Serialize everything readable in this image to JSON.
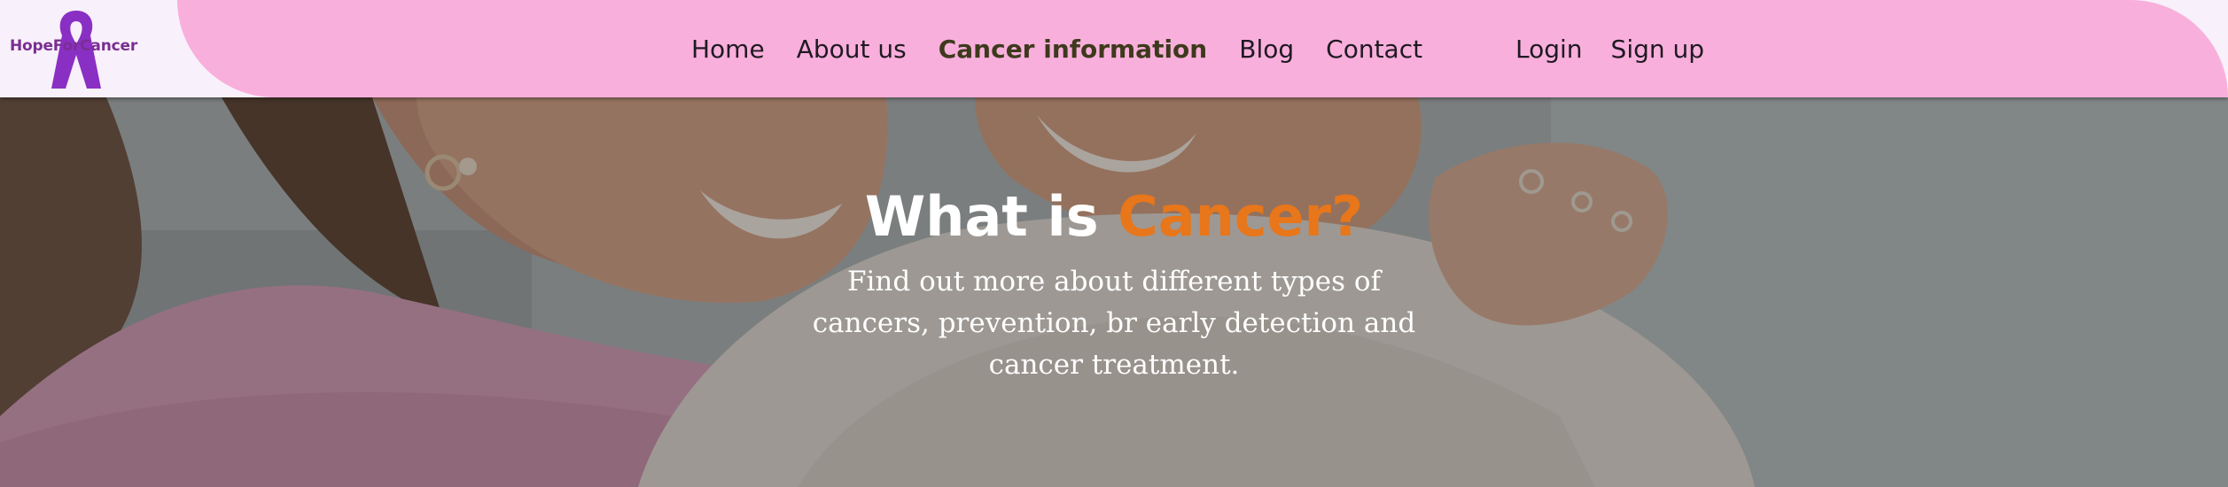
{
  "brand": {
    "name": "HopeForCancer",
    "color": "#7a2e92",
    "mark_color": "#8a2fc4"
  },
  "nav": {
    "items": [
      {
        "label": "Home",
        "active": false
      },
      {
        "label": "About us",
        "active": false
      },
      {
        "label": "Cancer information",
        "active": true
      },
      {
        "label": "Blog",
        "active": false
      },
      {
        "label": "Contact",
        "active": false
      }
    ],
    "login_label": "Login",
    "signup_label": "Sign up",
    "background_color": "#f9afdc"
  },
  "hero": {
    "title_prefix": "What is ",
    "title_accent": "Cancer?",
    "accent_color": "#e8761a",
    "subtitle": "Find out more about different types of cancers, prevention, br early detection and cancer treatment."
  }
}
